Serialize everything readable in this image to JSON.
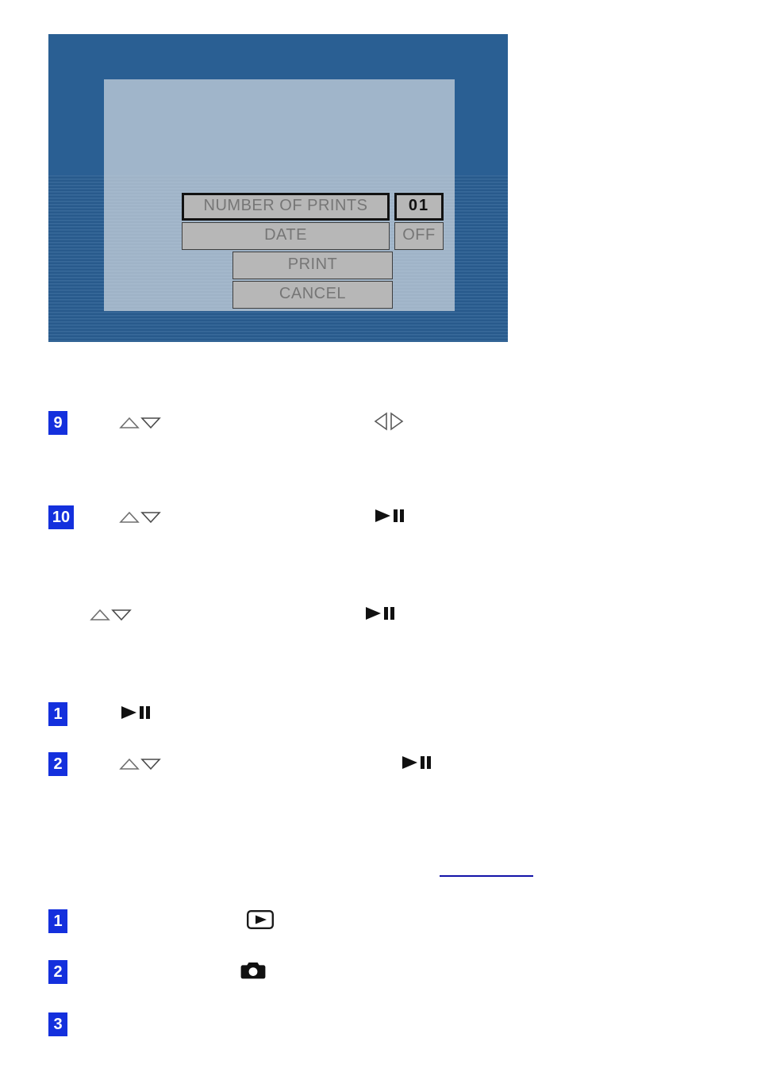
{
  "figure": {
    "name": "camera-lcd-print-settings-screen",
    "overlay_dialog": {
      "rows": [
        {
          "label": "NUMBER OF PRINTS",
          "value": "01",
          "label_selected": true,
          "value_active": true
        },
        {
          "label": "DATE",
          "value": "OFF",
          "label_selected": false,
          "value_active": false
        }
      ],
      "actions": [
        {
          "label": "PRINT"
        },
        {
          "label": "CANCEL"
        }
      ]
    },
    "colors": {
      "button_fill": "#b7b7b7",
      "button_border": "#3e3e3e",
      "button_text": "#767676",
      "active_text": "#101010",
      "panel_overlay": "rgba(232,234,236,.62)"
    }
  },
  "steps": [
    {
      "number": "9",
      "icons": [
        "up-down-triangle-buttons",
        "left-right-triangle-buttons"
      ]
    },
    {
      "number": "10",
      "icons": [
        "up-down-triangle-buttons",
        "play-pause-button"
      ]
    },
    {
      "number": "",
      "icons": [
        "up-down-triangle-buttons",
        "play-pause-button"
      ]
    },
    {
      "number": "1",
      "icons": [
        "play-pause-button"
      ]
    },
    {
      "number": "2",
      "icons": [
        "up-down-triangle-buttons",
        "play-pause-button"
      ]
    },
    {
      "number": "1",
      "icons": [
        "playback-mode-button"
      ]
    },
    {
      "number": "2",
      "icons": [
        "camera-mode-button"
      ]
    },
    {
      "number": "3",
      "icons": []
    }
  ],
  "link": {
    "name": "cross-reference-link",
    "color": "#1212a8"
  },
  "badge_color": "#1430dd"
}
